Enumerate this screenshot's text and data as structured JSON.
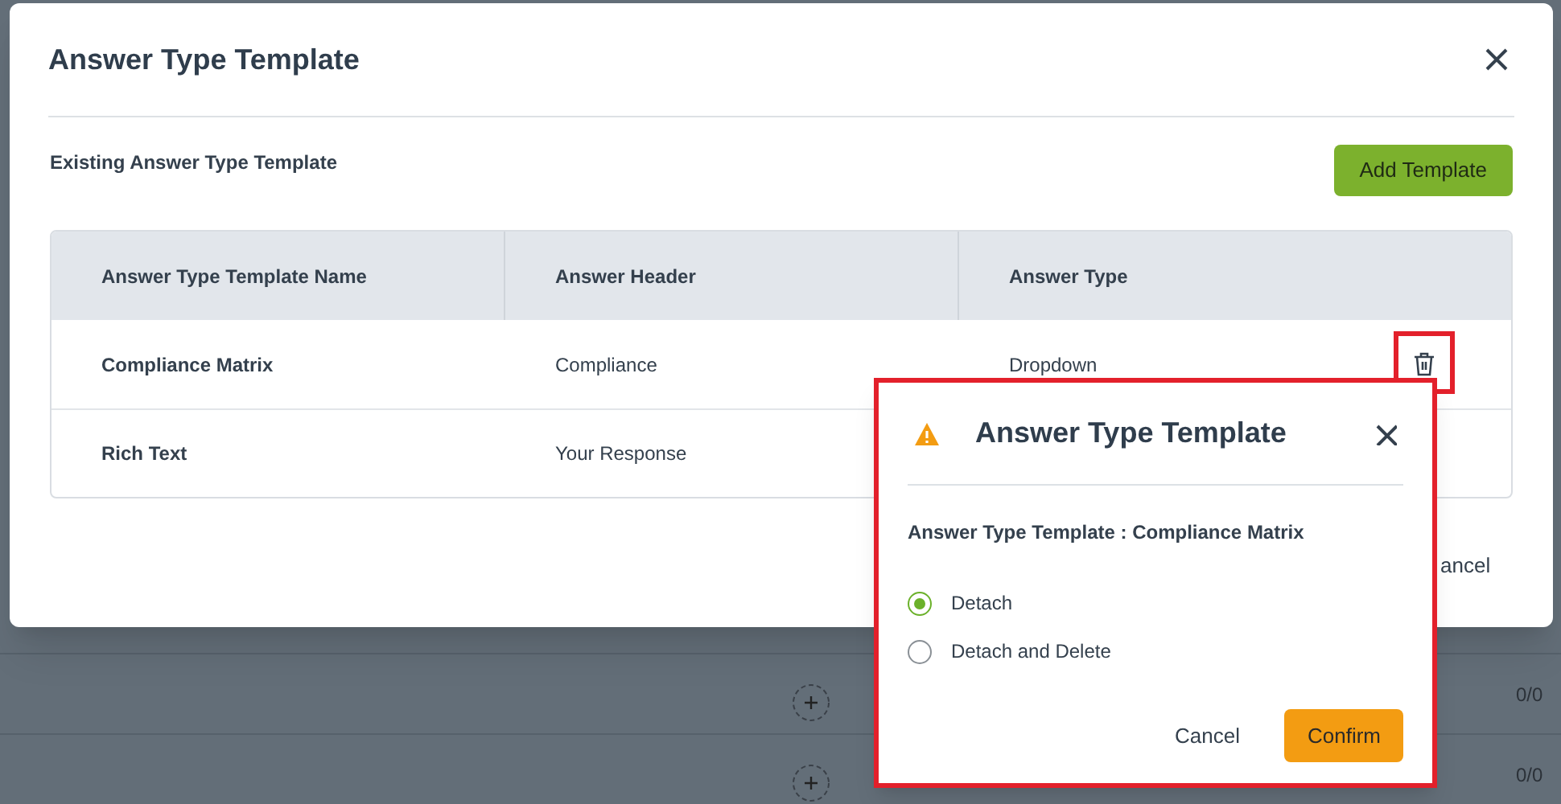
{
  "background_rows": [
    {
      "count": "0/0"
    },
    {
      "count": "0/0"
    }
  ],
  "modal": {
    "title": "Answer Type Template",
    "subtitle": "Existing Answer Type Template",
    "add_button": "Add Template",
    "columns": [
      "Answer Type Template Name",
      "Answer Header",
      "Answer Type"
    ],
    "rows": [
      {
        "cells": [
          "Compliance Matrix",
          "Compliance",
          "Dropdown"
        ],
        "highlighted": true
      },
      {
        "cells": [
          "Rich Text",
          "Your Response",
          ""
        ]
      }
    ],
    "footer_button": "ancel"
  },
  "confirm_dialog": {
    "title": "Answer Type Template",
    "message": "Answer Type Template : Compliance Matrix",
    "options": [
      {
        "label": "Detach",
        "selected": true
      },
      {
        "label": "Detach and Delete",
        "selected": false
      }
    ],
    "cancel": "Cancel",
    "confirm": "Confirm"
  }
}
